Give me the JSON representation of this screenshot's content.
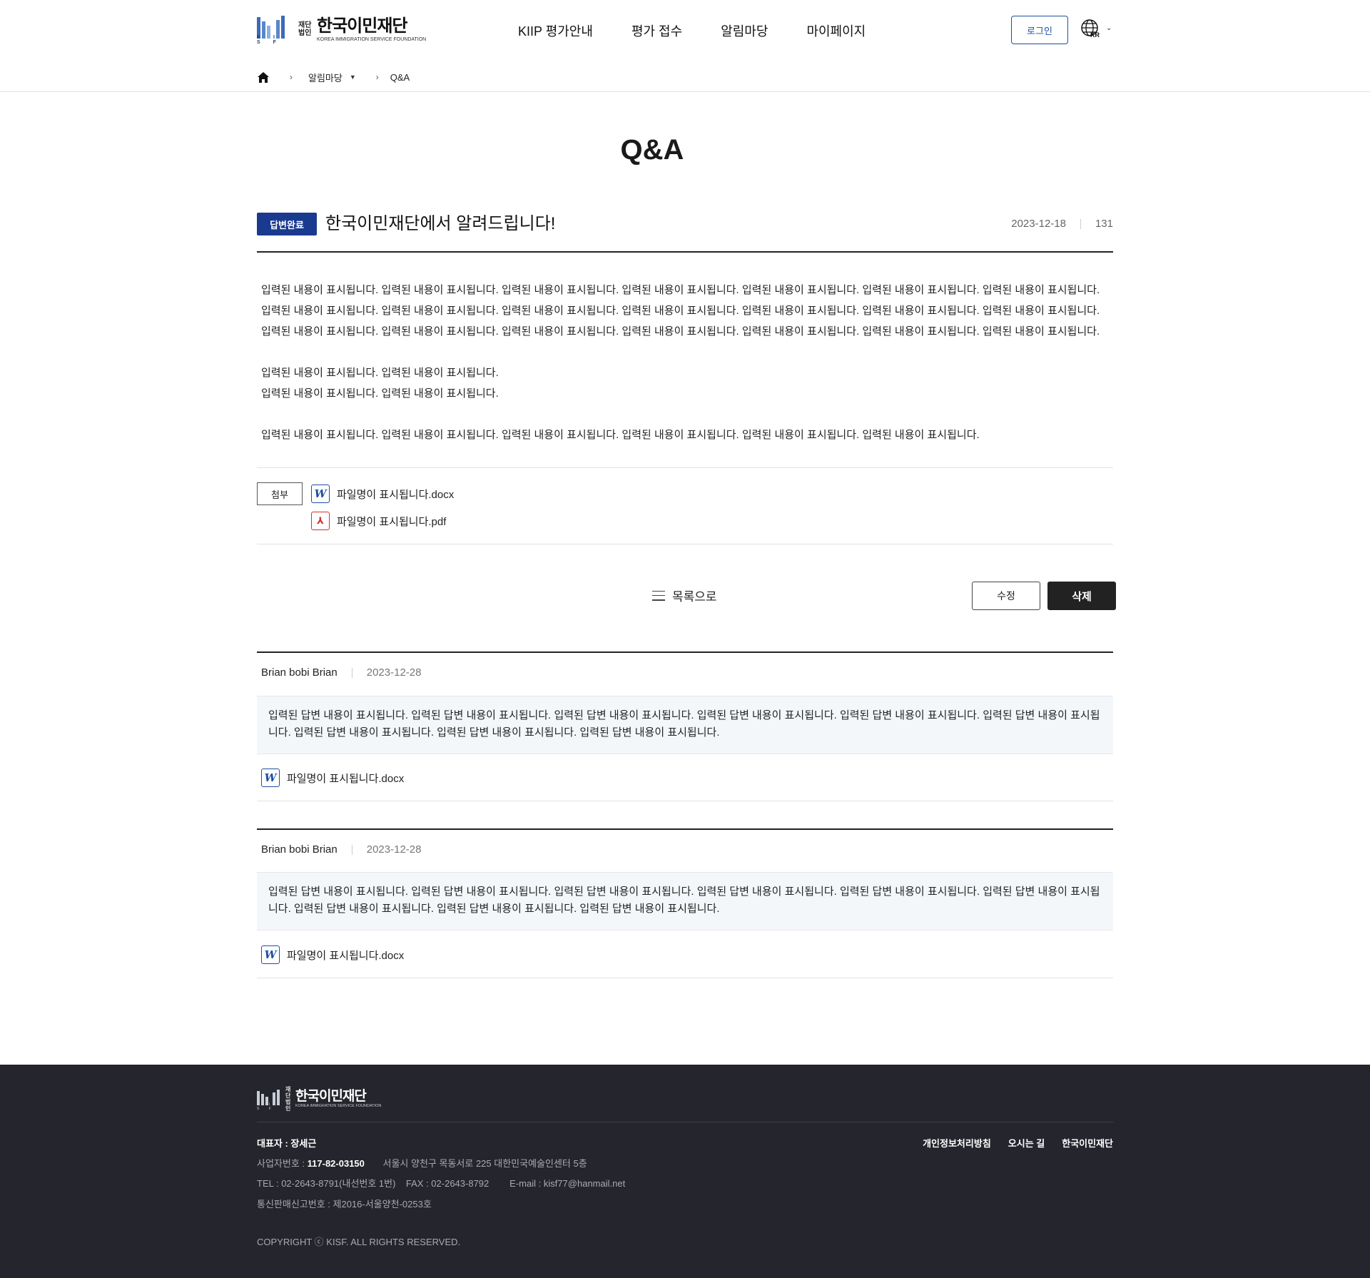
{
  "header": {
    "logo": {
      "small": "재단법인",
      "name": "한국이민재단",
      "en": "KOREA IMMIGRATION SERVICE FOUNDATION",
      "mark": "K I S F"
    },
    "nav": [
      "KIIP 평가안내",
      "평가 접수",
      "알림마당",
      "마이페이지"
    ],
    "login_label": "로그인",
    "lang_code": "KR"
  },
  "breadcrumb": {
    "section": "알림마당",
    "current": "Q&A"
  },
  "page_title": "Q&A",
  "article": {
    "badge": "답변완료",
    "title": "한국이민재단에서 알려드립니다!",
    "date": "2023-12-18",
    "views": "131",
    "paragraphs": [
      "입력된 내용이 표시됩니다. 입력된 내용이 표시됩니다. 입력된 내용이 표시됩니다. 입력된 내용이 표시됩니다. 입력된 내용이 표시됩니다. 입력된 내용이 표시됩니다. 입력된 내용이 표시됩니다.",
      "입력된 내용이 표시됩니다. 입력된 내용이 표시됩니다. 입력된 내용이 표시됩니다. 입력된 내용이 표시됩니다. 입력된 내용이 표시됩니다. 입력된 내용이 표시됩니다. 입력된 내용이 표시됩니다.",
      "입력된 내용이 표시됩니다. 입력된 내용이 표시됩니다. 입력된 내용이 표시됩니다. 입력된 내용이 표시됩니다. 입력된 내용이 표시됩니다. 입력된 내용이 표시됩니다. 입력된 내용이 표시됩니다.",
      "입력된 내용이 표시됩니다. 입력된 내용이 표시됩니다.",
      "입력된 내용이 표시됩니다. 입력된 내용이 표시됩니다.",
      "입력된 내용이 표시됩니다. 입력된 내용이 표시됩니다. 입력된 내용이 표시됩니다. 입력된 내용이 표시됩니다. 입력된 내용이 표시됩니다. 입력된 내용이 표시됩니다."
    ],
    "attach_label": "첨부",
    "files": [
      {
        "name": "파일명이 표시됩니다.docx",
        "icon": "word-icon",
        "glyph": "W"
      },
      {
        "name": "파일명이 표시됩니다.pdf",
        "icon": "pdf-icon",
        "glyph": "⅄"
      }
    ]
  },
  "actions": {
    "list_label": "목록으로",
    "edit_label": "수정",
    "delete_label": "삭제"
  },
  "replies": [
    {
      "author": "Brian bobi Brian",
      "date": "2023-12-28",
      "body": "입력된 답변 내용이 표시됩니다. 입력된 답변 내용이 표시됩니다. 입력된 답변 내용이 표시됩니다. 입력된 답변 내용이 표시됩니다. 입력된 답변 내용이 표시됩니다. 입력된 답변 내용이 표시됩니다. 입력된 답변 내용이 표시됩니다. 입력된 답변 내용이 표시됩니다. 입력된 답변 내용이 표시됩니다.",
      "file": "파일명이 표시됩니다.docx"
    },
    {
      "author": "Brian bobi Brian",
      "date": "2023-12-28",
      "body": "입력된 답변 내용이 표시됩니다. 입력된 답변 내용이 표시됩니다. 입력된 답변 내용이 표시됩니다. 입력된 답변 내용이 표시됩니다. 입력된 답변 내용이 표시됩니다. 입력된 답변 내용이 표시됩니다. 입력된 답변 내용이 표시됩니다. 입력된 답변 내용이 표시됩니다. 입력된 답변 내용이 표시됩니다.",
      "file": "파일명이 표시됩니다.docx"
    }
  ],
  "footer": {
    "rep": "대표자 : 장세근",
    "links": [
      "개인정보처리방침",
      "오시는 길",
      "한국이민재단"
    ],
    "biz_label": "사업자번호 : ",
    "biz_no": "117-82-03150",
    "address": "서울시 양천구 목동서로 225 대한민국예술인센터 5층",
    "contact": "TEL : 02-2643-8791(내선번호 1번)    FAX : 02-2643-8792        E-mail : kisf77@hanmail.net",
    "mail_order": "통신판매신고번호 : 제2016-서울양천-0253호",
    "copyright": "COPYRIGHT ⓒ KISF. ALL RIGHTS RESERVED."
  },
  "colors": {
    "accent": "#1a3a8f",
    "footer_bg": "#24252d",
    "reply_bg": "#f4f7fa"
  }
}
